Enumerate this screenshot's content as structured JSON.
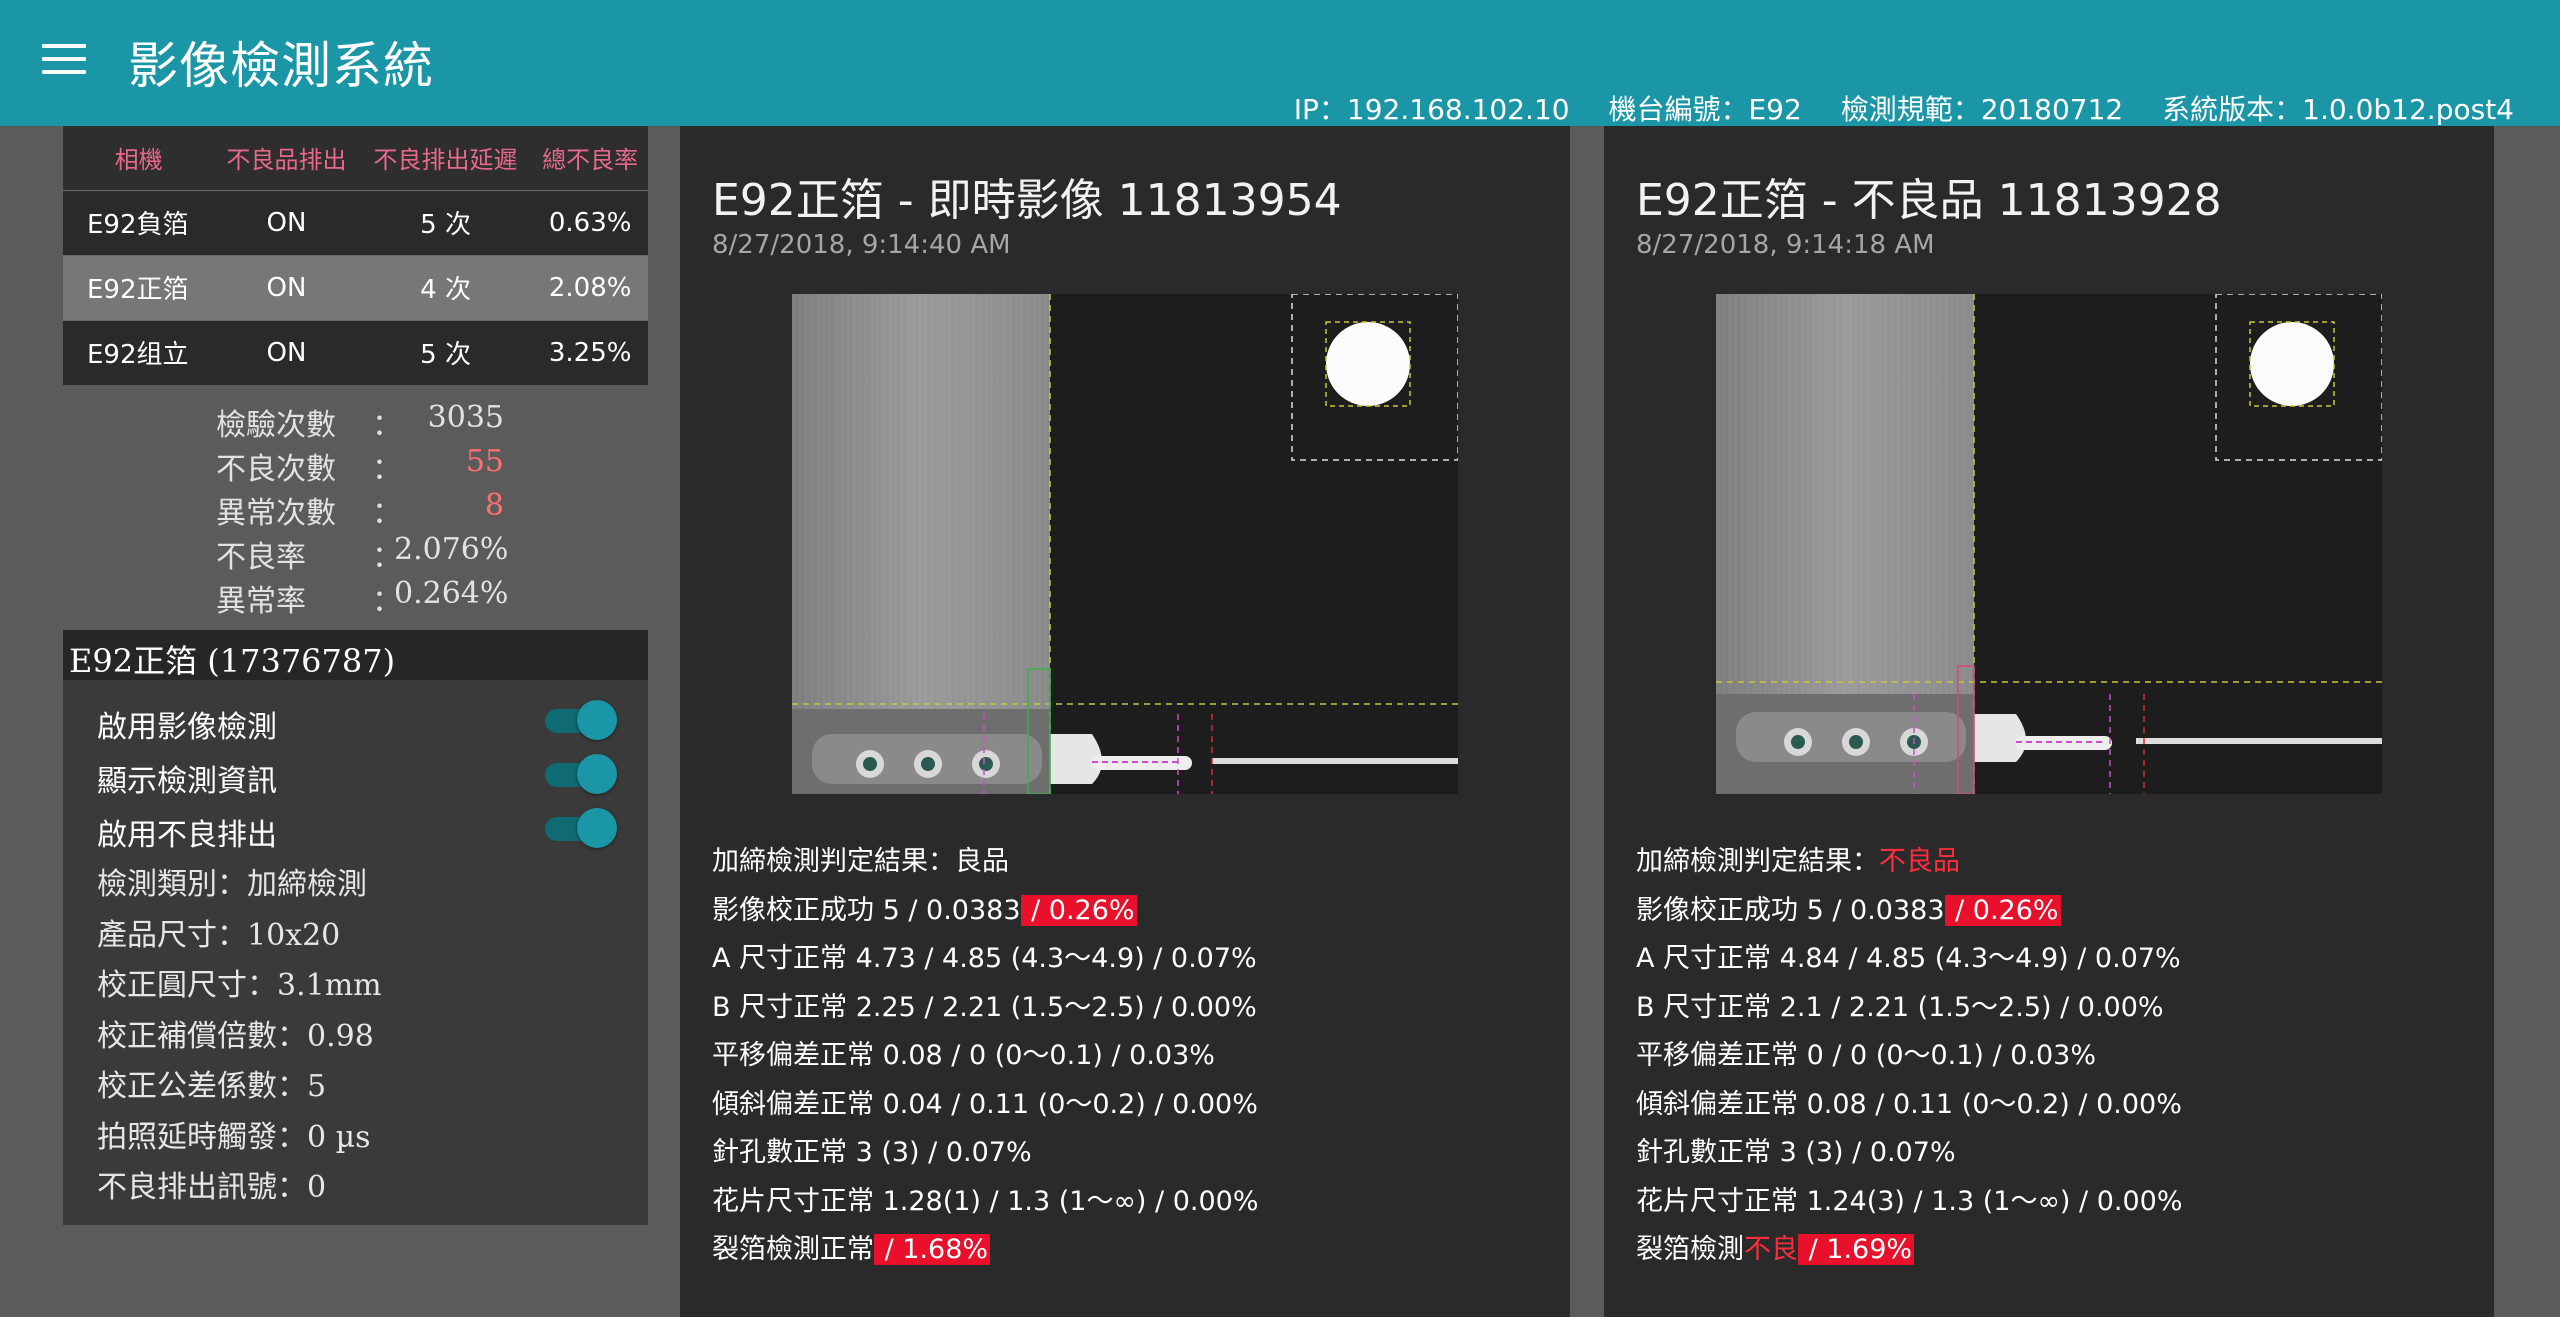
{
  "header": {
    "title": "影像檢測系統",
    "ip": "IP：192.168.102.10",
    "machine": "機台編號：E92",
    "spec": "檢測規範：20180712",
    "version": "系統版本：1.0.0b12.post4"
  },
  "camera_table": {
    "headers": [
      "相機",
      "不良品排出",
      "不良排出延遲",
      "總不良率"
    ],
    "rows": [
      {
        "name": "E92負箔",
        "eject": "ON",
        "delay": "5 次",
        "rate": "0.63%"
      },
      {
        "name": "E92正箔",
        "eject": "ON",
        "delay": "4 次",
        "rate": "2.08%"
      },
      {
        "name": "E92组立",
        "eject": "ON",
        "delay": "5 次",
        "rate": "3.25%"
      }
    ],
    "selected_index": 1
  },
  "stats": {
    "colon": "：",
    "items": [
      {
        "label": "檢驗次數",
        "value": "3035"
      },
      {
        "label": "不良次數",
        "value": "55"
      },
      {
        "label": "異常次數",
        "value": "8"
      },
      {
        "label": "不良率",
        "value": "2.076%"
      },
      {
        "label": "異常率",
        "value": "0.264%"
      }
    ]
  },
  "camera_detail": {
    "title": "E92正箔 (17376787)",
    "toggles": [
      {
        "label": "啟用影像檢測",
        "on": true
      },
      {
        "label": "顯示檢測資訊",
        "on": true
      },
      {
        "label": "啟用不良排出",
        "on": true
      }
    ],
    "params": [
      "檢測類別：加締檢測",
      "產品尺寸：10x20",
      "校正圓尺寸：3.1mm",
      "校正補償倍數：0.98",
      "校正公差係數：5",
      "拍照延時觸發：0 µs",
      "不良排出訊號：0"
    ]
  },
  "live_card": {
    "title": "E92正箔 - 即時影像 11813954",
    "time": "8/27/2018, 9:14:40 AM",
    "result_prefix": "加締檢測判定結果：",
    "result_value": "良品",
    "lines": {
      "calib": "影像校正成功 5 / 0.0383",
      "calib_hl": " / 0.26%",
      "a": "A 尺寸正常 4.73 / 4.85 (4.3～4.9) / 0.07%",
      "b": "B 尺寸正常 2.25 / 2.21 (1.5～2.5) / 0.00%",
      "shift": "平移偏差正常 0.08 / 0 (0～0.1) / 0.03%",
      "tilt": "傾斜偏差正常 0.04 / 0.11 (0～0.2) / 0.00%",
      "holes": "針孔數正常 3 (3) / 0.07%",
      "petal": "花片尺寸正常 1.28(1) / 1.3 (1～∞) / 0.00%",
      "crack": "裂箔檢測正常",
      "crack_hl": " / 1.68%"
    }
  },
  "ng_card": {
    "title": "E92正箔 - 不良品 11813928",
    "time": "8/27/2018, 9:14:18 AM",
    "result_prefix": "加締檢測判定結果：",
    "result_value": "不良品",
    "lines": {
      "calib": "影像校正成功 5 / 0.0383",
      "calib_hl": " / 0.26%",
      "a": "A 尺寸正常 4.84 / 4.85 (4.3～4.9) / 0.07%",
      "b": "B 尺寸正常 2.1 / 2.21 (1.5～2.5) / 0.00%",
      "shift": "平移偏差正常 0 / 0 (0～0.1) / 0.03%",
      "tilt": "傾斜偏差正常 0.08 / 0.11 (0～0.2) / 0.00%",
      "holes": "針孔數正常 3 (3) / 0.07%",
      "petal": "花片尺寸正常 1.24(3) / 1.3 (1～∞) / 0.00%",
      "crack": "裂箔檢測",
      "crack_ng": "不良",
      "crack_hl": " / 1.69%"
    }
  },
  "colors": {
    "appbar": "#1a96a6",
    "header_pink": "#e8688a",
    "highlight_red": "#e8102a",
    "stat_red": "#ff6f6f"
  },
  "icons": [
    "menu-icon"
  ]
}
